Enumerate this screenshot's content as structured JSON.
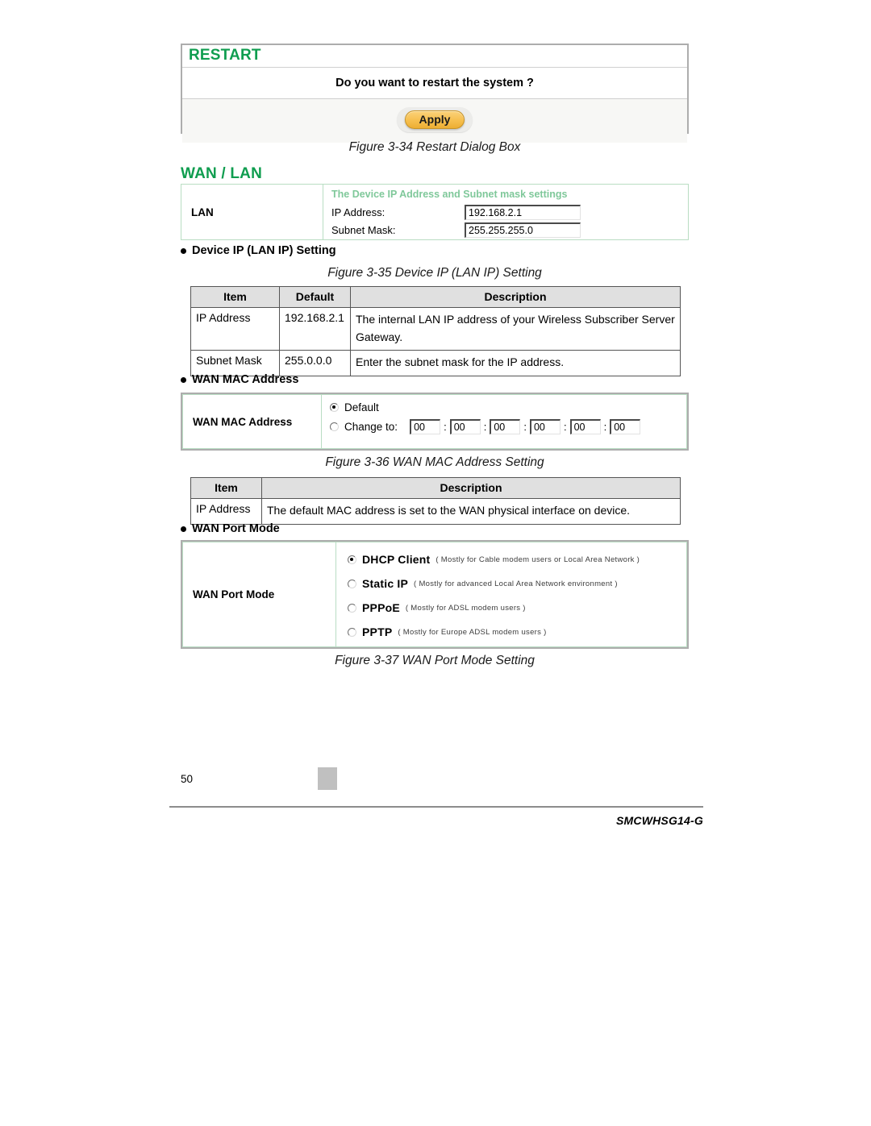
{
  "restart_panel": {
    "title": "RESTART",
    "question": "Do you want to restart the system ?",
    "apply_label": "Apply"
  },
  "captions": {
    "fig_34": "Figure 3-34 Restart Dialog Box",
    "fig_35": "Figure 3-35 Device IP (LAN IP) Setting",
    "fig_36": "Figure 3-36 WAN MAC Address Setting",
    "fig_37": "Figure 3-37 WAN Port Mode Setting"
  },
  "wanlan_panel": {
    "title": "WAN / LAN",
    "row_label": "LAN",
    "subhead": "The Device IP Address and Subnet mask settings",
    "fields": [
      {
        "label": "IP Address:",
        "value": "192.168.2.1"
      },
      {
        "label": "Subnet Mask:",
        "value": "255.255.255.0"
      }
    ]
  },
  "headings": {
    "device_ip": "Device IP (LAN IP) Setting",
    "wan_mac": "WAN MAC Address",
    "wan_port_mode": "WAN Port Mode"
  },
  "table_device_ip": {
    "columns": [
      "Item",
      "Default",
      "Description"
    ],
    "rows": [
      {
        "item": "IP Address",
        "default": "192.168.2.1",
        "description": "The internal LAN IP address of your Wireless Subscriber Server Gateway."
      },
      {
        "item": "Subnet Mask",
        "default": "255.0.0.0",
        "description": "Enter the subnet mask for the IP address."
      }
    ]
  },
  "mac_panel": {
    "row_label": "WAN MAC Address",
    "option_default": "Default",
    "option_change": "Change to:",
    "selected": "Default",
    "octets": [
      "00",
      "00",
      "00",
      "00",
      "00",
      "00"
    ],
    "separator": ":"
  },
  "table_wan_mac": {
    "columns": [
      "Item",
      "Description"
    ],
    "rows": [
      {
        "item": "IP Address",
        "description": "The default MAC address is set to the WAN physical interface on device."
      }
    ]
  },
  "port_mode_panel": {
    "row_label": "WAN Port Mode",
    "selected": "DHCP Client",
    "options": [
      {
        "name": "DHCP Client",
        "hint": "( Mostly for Cable modem users or Local Area Network )"
      },
      {
        "name": "Static IP",
        "hint": "( Mostly for advanced Local Area Network environment )"
      },
      {
        "name": "PPPoE",
        "hint": "( Mostly for ADSL modem users )"
      },
      {
        "name": "PPTP",
        "hint": "( Mostly for Europe ADSL modem users )"
      }
    ]
  },
  "footer": {
    "page_number": "50",
    "model": "SMCWHSG14-G"
  },
  "colors": {
    "brand_green": "#0f9d4f",
    "panel_green_border": "#b9ddc3",
    "subhead_green": "#7fc89a",
    "apply_orange": "#f6bf4e",
    "table_header_gray": "#e0e0e0"
  }
}
